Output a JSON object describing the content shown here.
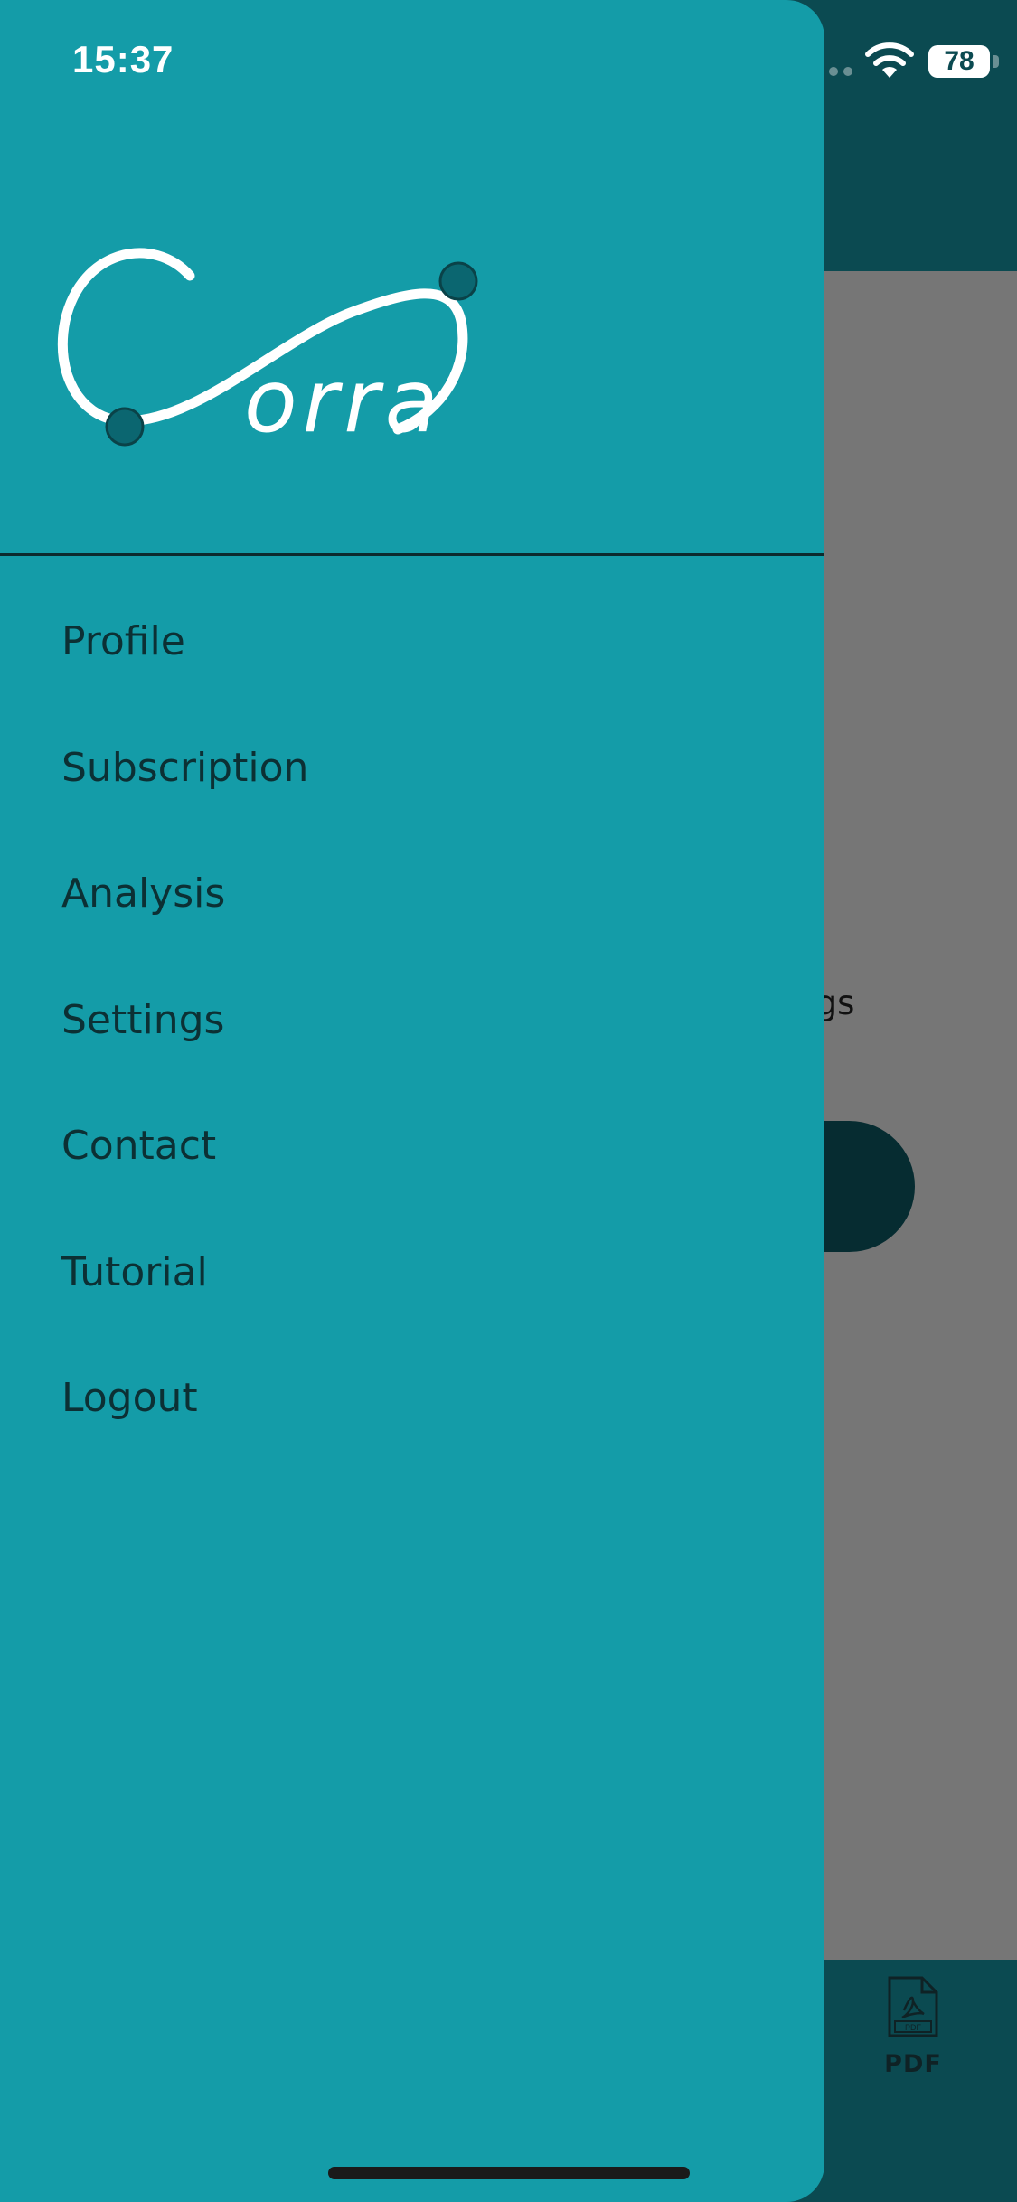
{
  "status_bar": {
    "time": "15:37",
    "battery_level": "78",
    "icons": [
      "signal-icon",
      "wifi-icon",
      "battery-icon"
    ]
  },
  "drawer": {
    "logo_alt": "Corra",
    "menu": [
      {
        "id": "profile",
        "label": "Profile"
      },
      {
        "id": "subscription",
        "label": "Subscription"
      },
      {
        "id": "analysis",
        "label": "Analysis"
      },
      {
        "id": "settings",
        "label": "Settings"
      },
      {
        "id": "contact",
        "label": "Contact"
      },
      {
        "id": "tutorial",
        "label": "Tutorial"
      },
      {
        "id": "logout",
        "label": "Logout"
      }
    ]
  },
  "background": {
    "partial_text": "ogs",
    "footer_tab_label": "PDF",
    "footer_icon": "pdf-file-icon"
  },
  "colors": {
    "drawer": "#149ca8",
    "header": "#0b4a51",
    "overlay": "#767676",
    "text": "#0c3034"
  }
}
